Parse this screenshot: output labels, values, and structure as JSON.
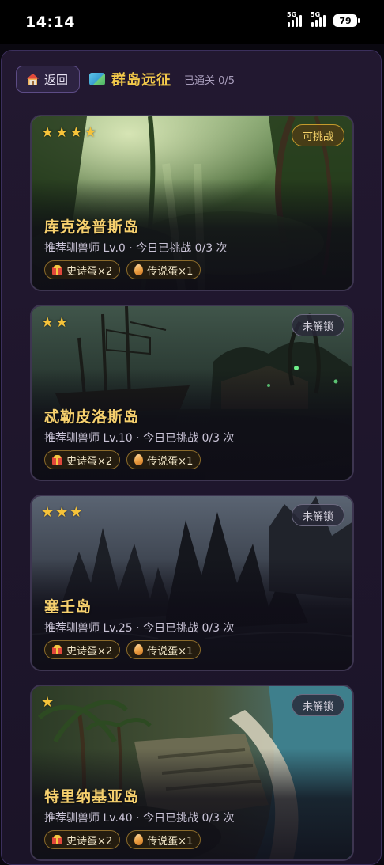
{
  "status_bar": {
    "time": "14:14",
    "signal1_label": "5G",
    "signal2_label": "5G",
    "battery": "79"
  },
  "header": {
    "back_label": "返回",
    "title": "群岛远征",
    "progress": "已通关 0/5"
  },
  "islands": [
    {
      "name": "库克洛普斯岛",
      "stars": 4,
      "status": "可挑战",
      "info": "推荐驯兽师 Lv.0 · 今日已挑战 0/3 次",
      "reward1": "史诗蛋×2",
      "reward2": "传说蛋×1",
      "scene": "jungle"
    },
    {
      "name": "忒勒皮洛斯岛",
      "stars": 2,
      "status": "未解锁",
      "info": "推荐驯兽师 Lv.10 · 今日已挑战 0/3 次",
      "reward1": "史诗蛋×2",
      "reward2": "传说蛋×1",
      "scene": "shipwreck"
    },
    {
      "name": "塞壬岛",
      "stars": 3,
      "status": "未解锁",
      "info": "推荐驯兽师 Lv.25 · 今日已挑战 0/3 次",
      "reward1": "史诗蛋×2",
      "reward2": "传说蛋×1",
      "scene": "rocks"
    },
    {
      "name": "特里纳基亚岛",
      "stars": 1,
      "status": "未解锁",
      "info": "推荐驯兽师 Lv.40 · 今日已挑战 0/3 次",
      "reward1": "史诗蛋×2",
      "reward2": "传说蛋×1",
      "scene": "beach"
    }
  ],
  "colors": {
    "accent_gold": "#f3c94a",
    "panel_bg": "#1f162c",
    "card_border": "#3d3550"
  }
}
